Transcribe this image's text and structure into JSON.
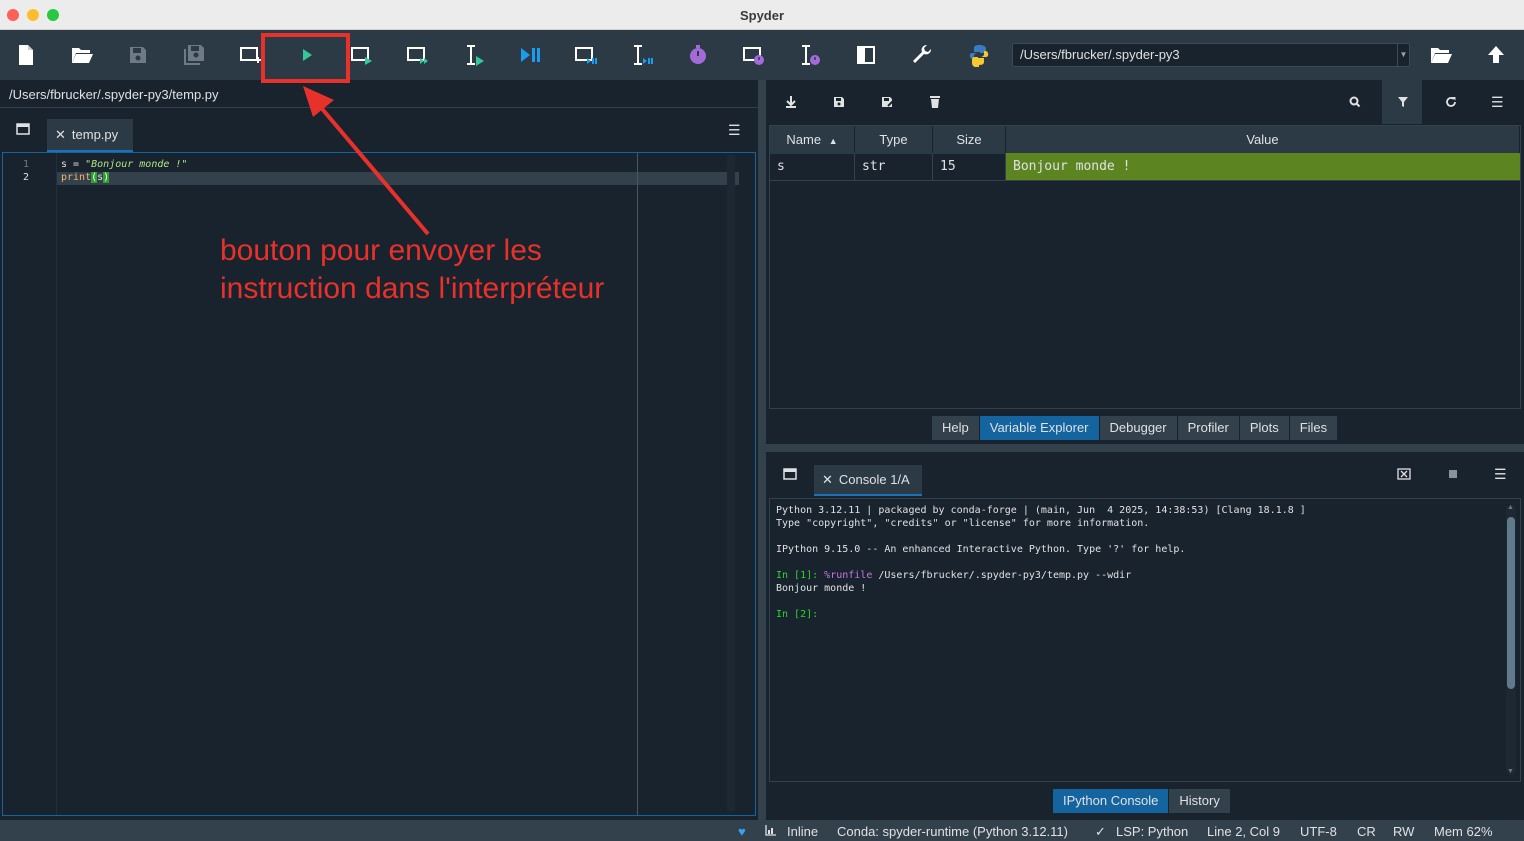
{
  "window": {
    "title": "Spyder"
  },
  "toolbar": {
    "icons": [
      "new-file-icon",
      "open-file-icon",
      "save-icon",
      "save-all-icon",
      "new-cell-icon",
      "run-file-icon",
      "run-cell-icon",
      "run-cell-advance-icon",
      "run-selection-icon",
      "debug-file-icon",
      "debug-cell-icon",
      "debug-selection-icon",
      "profile-file-icon",
      "profile-cell-icon",
      "profile-selection-icon",
      "maximize-pane-icon",
      "preferences-icon",
      "python-path-icon"
    ],
    "working_directory": "/Users/fbrucker/.spyder-py3"
  },
  "annotation": {
    "text_line1": "bouton pour envoyer les",
    "text_line2": "instruction dans l'interpréteur",
    "color": "#e8312b"
  },
  "editor": {
    "path": "/Users/fbrucker/.spyder-py3/temp.py",
    "tab_label": "temp.py",
    "lines": [
      {
        "number": "1",
        "var": "s",
        "op": " = ",
        "string": "\"Bonjour monde !\""
      },
      {
        "number": "2",
        "func": "print",
        "open": "(",
        "arg": "s",
        "close": ")"
      }
    ]
  },
  "variable_explorer": {
    "columns": [
      "Name",
      "Type",
      "Size",
      "Value"
    ],
    "rows": [
      {
        "name": "s",
        "type": "str",
        "size": "15",
        "value": "Bonjour monde !"
      }
    ],
    "value_color": "#5c8522",
    "tabs": [
      "Help",
      "Variable Explorer",
      "Debugger",
      "Profiler",
      "Plots",
      "Files"
    ],
    "active_tab": "Variable Explorer"
  },
  "console": {
    "tab_label": "Console 1/A",
    "banner_line1": "Python 3.12.11 | packaged by conda-forge | (main, Jun  4 2025, 14:38:53) [Clang 18.1.8 ]",
    "banner_line2": "Type \"copyright\", \"credits\" or \"license\" for more information.",
    "banner_line3": "IPython 9.15.0 -- An enhanced Interactive Python. Type '?' for help.",
    "prompt1": "In [1]: ",
    "magic": "%runfile",
    "command_rest": " /Users/fbrucker/.spyder-py3/temp.py --wdir",
    "output": "Bonjour monde !",
    "prompt2": "In [2]:",
    "tabs": [
      "IPython Console",
      "History"
    ],
    "active_tab": "IPython Console"
  },
  "statusbar": {
    "plots_backend": "Inline",
    "conda_env": "Conda: spyder-runtime (Python 3.12.11)",
    "lsp": "LSP: Python",
    "cursor": "Line 2, Col 9",
    "encoding": "UTF-8",
    "eol": "CR",
    "permissions": "RW",
    "memory": "Mem 62%"
  }
}
